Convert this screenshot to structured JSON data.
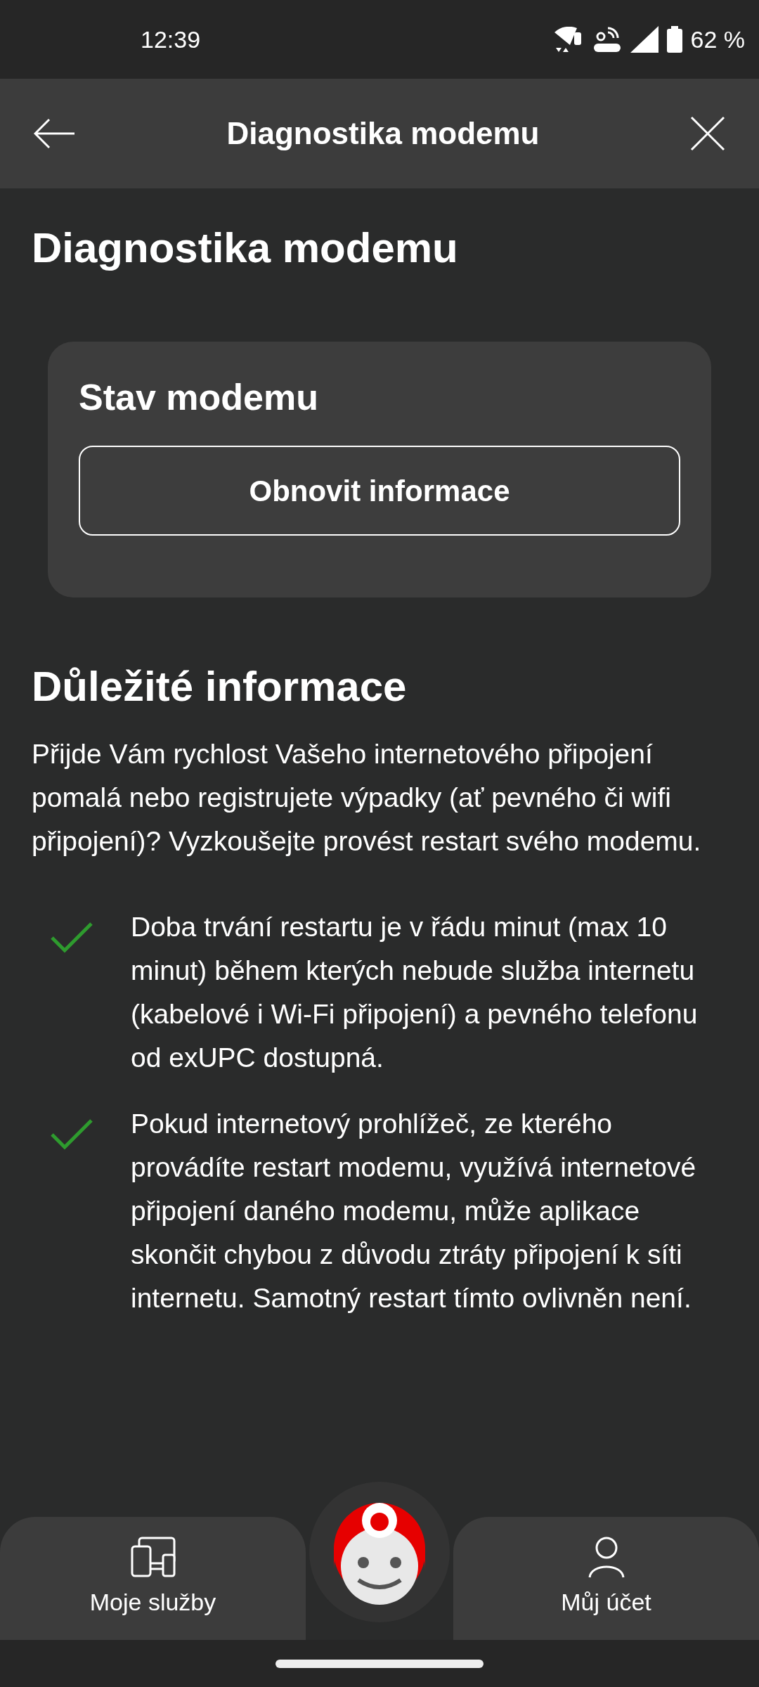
{
  "status_bar": {
    "time": "12:39",
    "battery": "62 %"
  },
  "header": {
    "title": "Diagnostika modemu"
  },
  "page_title": "Diagnostika modemu",
  "modem_card": {
    "title": "Stav modemu",
    "button": "Obnovit informace"
  },
  "info": {
    "heading": "Důležité informace",
    "paragraph": "Přijde Vám rychlost Vašeho internetového připojení pomalá nebo registrujete výpadky (ať pevného či wifi připojení)? Vyzkoušejte provést restart svého modemu.",
    "bullets": [
      "Doba trvání restartu je v řádu minut (max 10 minut) během kterých nebude služba internetu (kabelové i Wi-Fi připojení) a pevného telefonu od exUPC dostupná.",
      "Pokud internetový prohlížeč, ze kterého provádíte restart modemu, využívá internetové připojení daného modemu, může aplikace skončit chybou z důvodu ztráty připojení k síti internetu. Samotný restart tímto ovlivněn není."
    ]
  },
  "bottom_nav": [
    {
      "kind": "services",
      "label": "Moje služby"
    },
    {
      "kind": "account",
      "label": "Můj účet"
    }
  ]
}
